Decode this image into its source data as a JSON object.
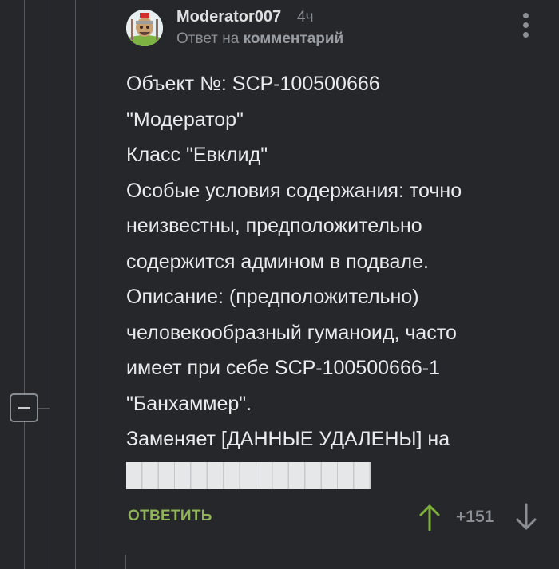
{
  "comment": {
    "author": "Moderator007",
    "time": "4ч",
    "reply_prefix": "Ответ на",
    "reply_link": "комментарий",
    "body_lines": [
      "Объект №: SCP-100500666",
      "\"Модератор\"",
      "Класс \"Евклид\"",
      "Особые условия содержания: точно",
      "неизвестны, предположительно",
      "содержится админом в подвале.",
      "Описание: (предположительно)",
      "человекообразный гуманоид, часто",
      "имеет при себе SCP-100500666-1",
      "\"Банхаммер\".",
      "Заменяет [ДАННЫЕ УДАЛЕНЫ] на"
    ],
    "redacted_block": "█████████████"
  },
  "actions": {
    "reply_label": "ОТВЕТИТЬ",
    "rating": "+151"
  },
  "icons": {
    "avatar": "avatar-icon",
    "menu": "more-vertical-icon",
    "collapse": "minus-icon",
    "upvote": "arrow-up-icon",
    "downvote": "arrow-down-icon"
  },
  "colors": {
    "background": "#25272b",
    "accent_green": "#8fb356",
    "muted_text": "#8b8e93"
  }
}
